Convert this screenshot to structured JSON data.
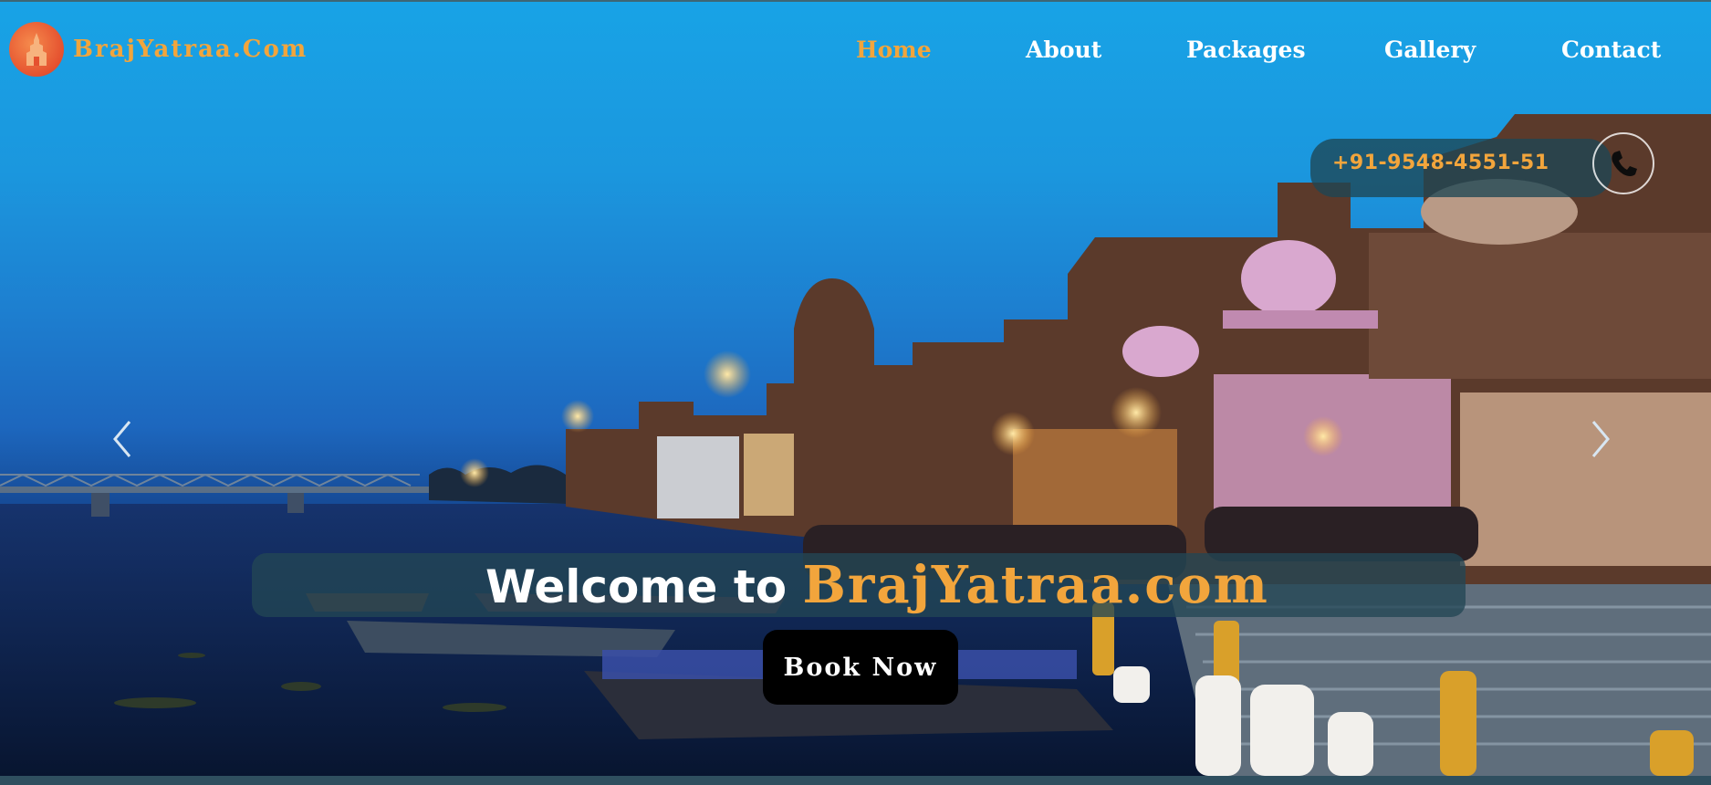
{
  "header": {
    "brand": "BrajYatraa.Com",
    "logo_icon": "temple-icon",
    "nav": [
      {
        "label": "Home",
        "active": true
      },
      {
        "label": "About",
        "active": false
      },
      {
        "label": "Packages",
        "active": false
      },
      {
        "label": "Gallery",
        "active": false
      },
      {
        "label": "Contact",
        "active": false
      }
    ]
  },
  "contact": {
    "phone": "+91-9548-4551-51",
    "phone_icon": "phone-icon"
  },
  "hero": {
    "welcome_prefix": "Welcome to",
    "welcome_brand": "BrajYatraa.com",
    "cta_label": "Book Now",
    "prev_icon": "chevron-left-icon",
    "next_icon": "chevron-right-icon"
  },
  "colors": {
    "accent": "#f2a53c",
    "sky": "#1b97de",
    "cta_bg": "#000000"
  }
}
